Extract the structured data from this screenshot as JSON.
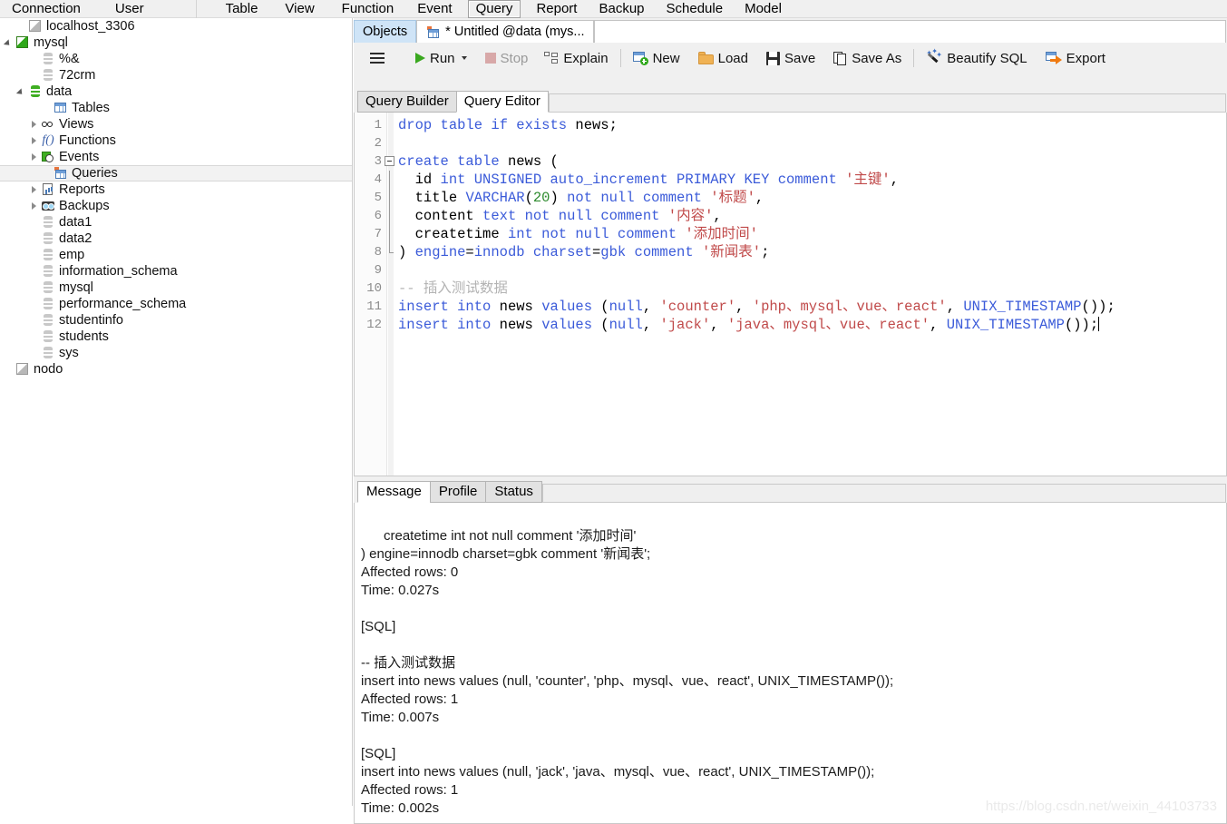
{
  "menubar": {
    "items": [
      {
        "label": "Connection",
        "selected": false
      },
      {
        "label": "User",
        "selected": false
      },
      {
        "label": "Table",
        "selected": false
      },
      {
        "label": "View",
        "selected": false
      },
      {
        "label": "Function",
        "selected": false
      },
      {
        "label": "Event",
        "selected": false
      },
      {
        "label": "Query",
        "selected": true
      },
      {
        "label": "Report",
        "selected": false
      },
      {
        "label": "Backup",
        "selected": false
      },
      {
        "label": "Schedule",
        "selected": false
      },
      {
        "label": "Model",
        "selected": false
      }
    ]
  },
  "sidebar": {
    "tree": [
      {
        "label": "localhost_3306",
        "indent": 1,
        "icon": "connection-grey-icon",
        "twisty": "none",
        "selected": false
      },
      {
        "label": "mysql",
        "indent": 0,
        "icon": "connection-green-icon",
        "twisty": "open",
        "selected": false
      },
      {
        "label": "%&",
        "indent": 2,
        "icon": "database-grey-icon",
        "twisty": "none",
        "selected": false
      },
      {
        "label": "72crm",
        "indent": 2,
        "icon": "database-grey-icon",
        "twisty": "none",
        "selected": false
      },
      {
        "label": "data",
        "indent": 1,
        "icon": "database-green-icon",
        "twisty": "open",
        "selected": false
      },
      {
        "label": "Tables",
        "indent": 3,
        "icon": "tables-icon",
        "twisty": "none",
        "selected": false
      },
      {
        "label": "Views",
        "indent": 2,
        "icon": "views-icon",
        "twisty": "closed",
        "selected": false
      },
      {
        "label": "Functions",
        "indent": 2,
        "icon": "functions-icon",
        "twisty": "closed",
        "selected": false
      },
      {
        "label": "Events",
        "indent": 2,
        "icon": "events-icon",
        "twisty": "closed",
        "selected": false
      },
      {
        "label": "Queries",
        "indent": 3,
        "icon": "queries-icon",
        "twisty": "none",
        "selected": true
      },
      {
        "label": "Reports",
        "indent": 2,
        "icon": "reports-icon",
        "twisty": "closed",
        "selected": false
      },
      {
        "label": "Backups",
        "indent": 2,
        "icon": "backups-icon",
        "twisty": "closed",
        "selected": false
      },
      {
        "label": "data1",
        "indent": 2,
        "icon": "database-grey-icon",
        "twisty": "none",
        "selected": false
      },
      {
        "label": "data2",
        "indent": 2,
        "icon": "database-grey-icon",
        "twisty": "none",
        "selected": false
      },
      {
        "label": "emp",
        "indent": 2,
        "icon": "database-grey-icon",
        "twisty": "none",
        "selected": false
      },
      {
        "label": "information_schema",
        "indent": 2,
        "icon": "database-grey-icon",
        "twisty": "none",
        "selected": false
      },
      {
        "label": "mysql",
        "indent": 2,
        "icon": "database-grey-icon",
        "twisty": "none",
        "selected": false
      },
      {
        "label": "performance_schema",
        "indent": 2,
        "icon": "database-grey-icon",
        "twisty": "none",
        "selected": false
      },
      {
        "label": "studentinfo",
        "indent": 2,
        "icon": "database-grey-icon",
        "twisty": "none",
        "selected": false
      },
      {
        "label": "students",
        "indent": 2,
        "icon": "database-grey-icon",
        "twisty": "none",
        "selected": false
      },
      {
        "label": "sys",
        "indent": 2,
        "icon": "database-grey-icon",
        "twisty": "none",
        "selected": false
      },
      {
        "label": "nodo",
        "indent": 0,
        "icon": "connection-grey-icon",
        "twisty": "none",
        "selected": false
      }
    ]
  },
  "doctabs": {
    "objects_label": "Objects",
    "query_label": "* Untitled @data (mys..."
  },
  "toolbar": {
    "menu_label": "",
    "run_label": "Run",
    "stop_label": "Stop",
    "explain_label": "Explain",
    "new_label": "New",
    "load_label": "Load",
    "save_label": "Save",
    "save_as_label": "Save As",
    "beautify_label": "Beautify SQL",
    "export_label": "Export"
  },
  "subtabs": {
    "builder_label": "Query Builder",
    "editor_label": "Query Editor",
    "active": "Query Editor"
  },
  "editor": {
    "lines": [
      {
        "no": "1",
        "fold": "none"
      },
      {
        "no": "2",
        "fold": "none"
      },
      {
        "no": "3",
        "fold": "open"
      },
      {
        "no": "4",
        "fold": "bar"
      },
      {
        "no": "5",
        "fold": "bar"
      },
      {
        "no": "6",
        "fold": "bar"
      },
      {
        "no": "7",
        "fold": "bar"
      },
      {
        "no": "8",
        "fold": "end"
      },
      {
        "no": "9",
        "fold": "none"
      },
      {
        "no": "10",
        "fold": "none"
      },
      {
        "no": "11",
        "fold": "none"
      },
      {
        "no": "12",
        "fold": "none"
      }
    ],
    "text": [
      "drop table if exists news;",
      "",
      "create table news (",
      "  id int UNSIGNED auto_increment PRIMARY KEY comment '主键',",
      "  title VARCHAR(20) not null comment '标题',",
      "  content text not null comment '内容',",
      "  createtime int not null comment '添加时间'",
      ") engine=innodb charset=gbk comment '新闻表';",
      "",
      "-- 插入测试数据",
      "insert into news values (null, 'counter', 'php、mysql、vue、react', UNIX_TIMESTAMP());",
      "insert into news values (null, 'jack', 'java、mysql、vue、react', UNIX_TIMESTAMP());"
    ]
  },
  "messages": {
    "tabs": [
      {
        "label": "Message",
        "active": true
      },
      {
        "label": "Profile",
        "active": false
      },
      {
        "label": "Status",
        "active": false
      }
    ],
    "body": "  createtime int not null comment '添加时间'\n) engine=innodb charset=gbk comment '新闻表';\nAffected rows: 0\nTime: 0.027s\n\n[SQL]\n\n-- 插入测试数据\ninsert into news values (null, 'counter', 'php、mysql、vue、react', UNIX_TIMESTAMP());\nAffected rows: 1\nTime: 0.007s\n\n[SQL]\ninsert into news values (null, 'jack', 'java、mysql、vue、react', UNIX_TIMESTAMP());\nAffected rows: 1\nTime: 0.002s"
  },
  "watermark": {
    "text": "https://blog.csdn.net/weixin_44103733"
  },
  "colors": {
    "keyword": "#3b5bd9",
    "string": "#c04a4a",
    "number": "#2e8b2e",
    "comment": "#b4b4b4",
    "accent_tab": "#cfe4f7",
    "run_green": "#3aa81f",
    "export_orange": "#f07a10"
  }
}
